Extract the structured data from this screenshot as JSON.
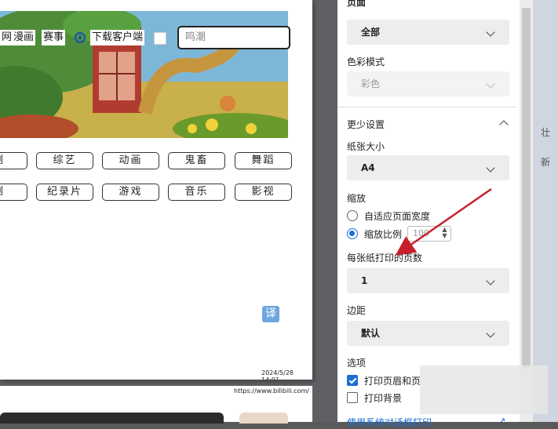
{
  "preview": {
    "nav": {
      "item1": "网",
      "item2": "漫画",
      "item3": "赛事",
      "download": "下载客户端"
    },
    "search_placeholder": "鸣潮",
    "categories_row1": [
      "剧",
      "综艺",
      "动画",
      "鬼畜",
      "舞蹈"
    ],
    "categories_row2": [
      "剧",
      "纪录片",
      "游戏",
      "音乐",
      "影视"
    ],
    "translate_label": "译",
    "footer_date": "2024/5/28 14:01",
    "page2_url": "https://www.bilibili.com/"
  },
  "settings": {
    "header_partial": "页面",
    "pages_value": "全部",
    "color_mode_label": "色彩模式",
    "color_mode_value": "彩色",
    "less_settings": "更少设置",
    "paper_size_label": "纸张大小",
    "paper_size_value": "A4",
    "scale_label": "缩放",
    "fit_page_width": "自适应页面宽度",
    "scale_ratio": "缩放比例",
    "scale_value": "100",
    "pages_per_sheet_label": "每张纸打印的页数",
    "pages_per_sheet_value": "1",
    "margins_label": "边距",
    "margins_value": "默认",
    "options_label": "选项",
    "print_headers": "打印页眉和页",
    "print_background": "打印背景",
    "system_dialog": "使用系统对话框打印",
    "print_headers_checked": true,
    "print_background_checked": false,
    "scale_mode": "custom"
  },
  "colors": {
    "accent": "#1a6fd6",
    "arrow": "#c8202a"
  },
  "background_right": {
    "frag1": "壮",
    "frag2": "新"
  }
}
